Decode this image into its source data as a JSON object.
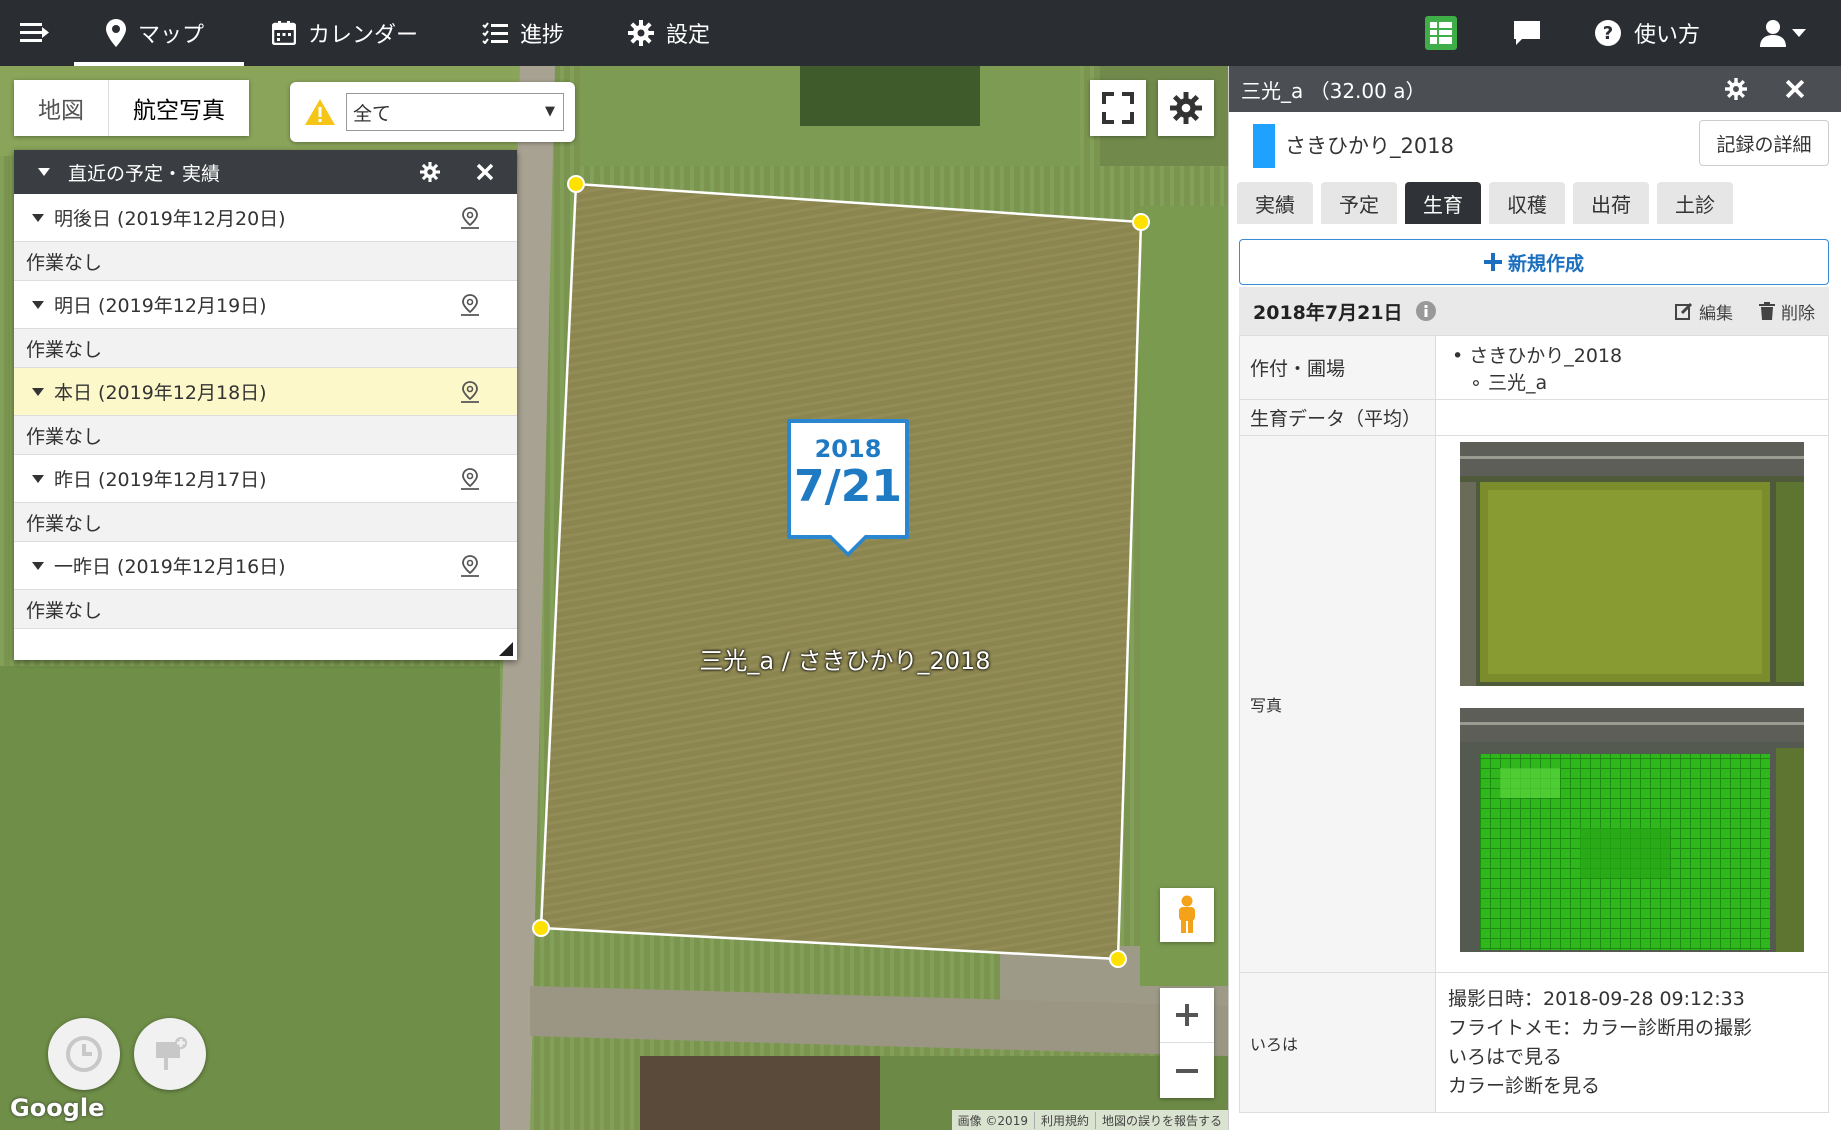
{
  "nav": {
    "map": "マップ",
    "calendar": "カレンダー",
    "progress": "進捗",
    "settings": "設定",
    "help": "使い方"
  },
  "map": {
    "tabs": [
      "地図",
      "航空写真"
    ],
    "filter_value": "全て",
    "callout_year": "2018",
    "callout_date": "7/21",
    "field_label": "三光_a / さきひかり_2018",
    "google": "Google",
    "attribution": [
      "画像 ©2019",
      "利用規約",
      "地図の誤りを報告する"
    ]
  },
  "schedule": {
    "title": "直近の予定・実績",
    "days": [
      {
        "label": "明後日 (2019年12月20日)",
        "note": "作業なし",
        "today": false
      },
      {
        "label": "明日 (2019年12月19日)",
        "note": "作業なし",
        "today": false
      },
      {
        "label": "本日 (2019年12月18日)",
        "note": "作業なし",
        "today": true
      },
      {
        "label": "昨日 (2019年12月17日)",
        "note": "作業なし",
        "today": false
      },
      {
        "label": "一昨日 (2019年12月16日)",
        "note": "作業なし",
        "today": false
      }
    ]
  },
  "panel": {
    "title": "三光_a （32.00 a）",
    "crop": "さきひかり_2018",
    "detail_button": "記録の詳細",
    "tabs": [
      "実績",
      "予定",
      "生育",
      "収穫",
      "出荷",
      "土診"
    ],
    "active_tab": "生育",
    "new_button": "新規作成",
    "record_date": "2018年7月21日",
    "edit": "編集",
    "delete": "削除",
    "rows": {
      "crop_field_key": "作付・圃場",
      "crop_item": "さきひかり_2018",
      "field_item": "三光_a",
      "growth_key": "生育データ（平均）",
      "photo_key": "写真",
      "iroha_key": "いろは"
    },
    "iroha": {
      "shot_time": "撮影日時：2018-09-28 09:12:33",
      "flight_memo": "フライトメモ：カラー診断用の撮影",
      "link1": "いろはで見る",
      "link2": "カラー診断を見る"
    }
  },
  "colors": {
    "topbar": "#2a2e33",
    "accent_blue": "#2b86d0",
    "crop_bar": "#1fa2ff",
    "today_row": "#fcf8c9",
    "vertex": "#ffe100"
  }
}
